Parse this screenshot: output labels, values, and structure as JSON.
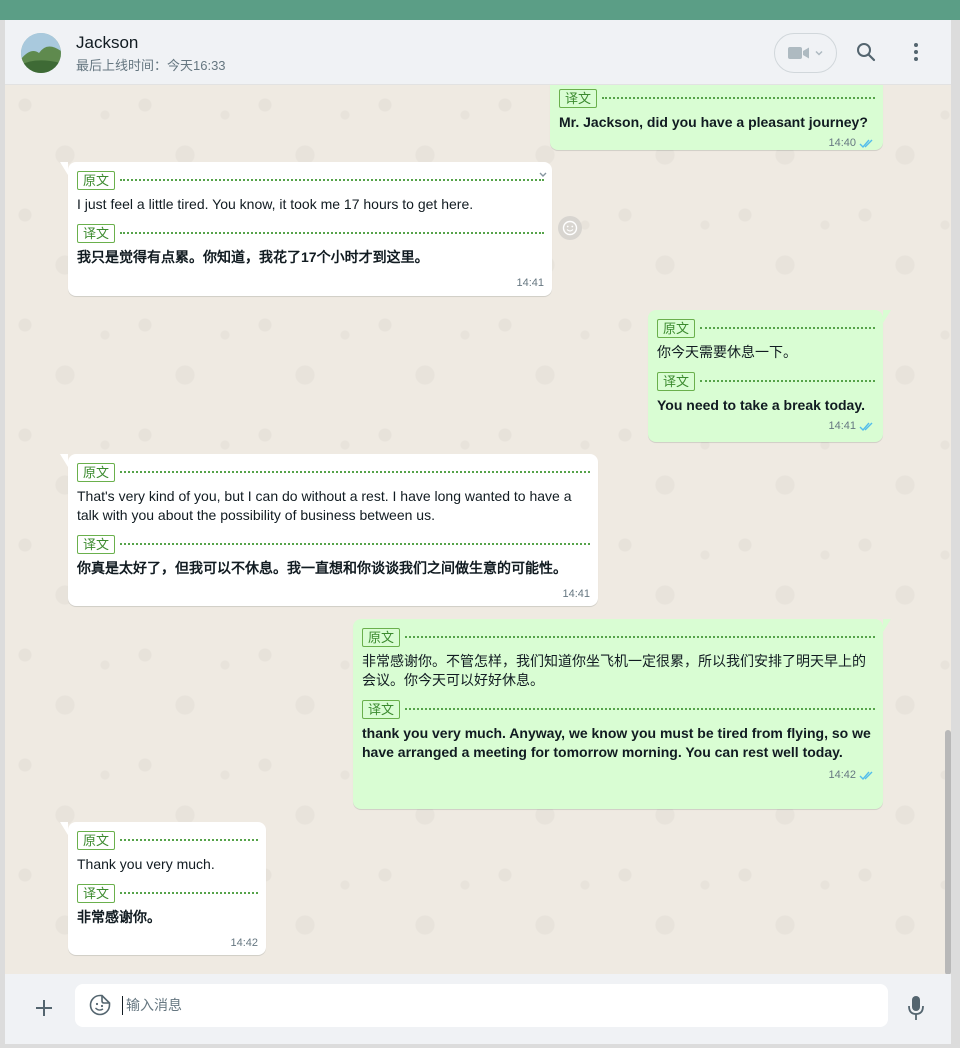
{
  "header": {
    "contact_name": "Jackson",
    "last_seen": "最后上线时间：今天16:33",
    "icons": [
      "avatar",
      "video-call-icon",
      "chevron-down-icon",
      "search-icon",
      "menu-dots-icon"
    ]
  },
  "labels": {
    "original": "原文",
    "translation": "译文"
  },
  "messages": [
    {
      "direction": "out",
      "original": "",
      "translation": "Mr. Jackson, did you have a pleasant journey?",
      "time": "14:40",
      "status": "read"
    },
    {
      "direction": "in",
      "original": "I just feel a little tired. You know, it took me 17 hours to get here.",
      "translation": "我只是觉得有点累。你知道，我花了17个小时才到这里。",
      "time": "14:41"
    },
    {
      "direction": "out",
      "original": "你今天需要休息一下。",
      "translation": "You need to take a break today.",
      "time": "14:41",
      "status": "read"
    },
    {
      "direction": "in",
      "original": "That's very kind of you, but I can do without a rest. I have long wanted to have a talk with you about the possibility of business between us.",
      "translation": "你真是太好了，但我可以不休息。我一直想和你谈谈我们之间做生意的可能性。",
      "time": "14:41"
    },
    {
      "direction": "out",
      "original": "非常感谢你。不管怎样，我们知道你坐飞机一定很累，所以我们安排了明天早上的会议。你今天可以好好休息。",
      "translation": "thank you very much. Anyway, we know you must be tired from flying, so we have arranged a meeting for tomorrow morning. You can rest well today.",
      "time": "14:42",
      "status": "read"
    },
    {
      "direction": "in",
      "original": "Thank you very much.",
      "translation": "非常感谢你。",
      "time": "14:42"
    }
  ],
  "composer": {
    "placeholder": "输入消息",
    "icons": [
      "plus-icon",
      "sticker-icon",
      "microphone-icon"
    ]
  },
  "colors": {
    "top_strip": "#5b9e86",
    "outgoing_bubble": "#d9fdd3",
    "incoming_bubble": "#ffffff",
    "tag_green": "#3b8a2e",
    "read_ticks": "#53bdeb"
  }
}
